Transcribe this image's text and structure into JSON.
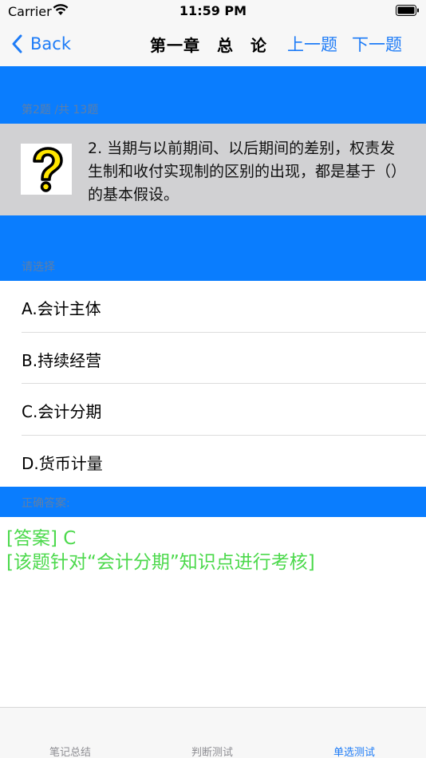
{
  "status": {
    "carrier": "Carrier",
    "time": "11:59 PM"
  },
  "nav": {
    "back_label": "Back",
    "title": "第一章　总　论",
    "prev_label": "上一题",
    "next_label": "下一题"
  },
  "question": {
    "counter": "第2题 /共 13题",
    "text": "2.  当期与以前期间、以后期间的差别，权责发生制和收付实现制的区别的出现，都是基于（）的基本假设。"
  },
  "options_section": {
    "label": "请选择",
    "items": [
      {
        "label": "A.会计主体"
      },
      {
        "label": "B.持续经营"
      },
      {
        "label": "C.会计分期"
      },
      {
        "label": "D.货币计量"
      }
    ]
  },
  "answer_section": {
    "label": "正确答案:",
    "answer_line": "[答案] C",
    "explanation_line": "[该题针对“会计分期”知识点进行考核]"
  },
  "tabs": [
    {
      "label": "笔记总结"
    },
    {
      "label": "判断测试"
    },
    {
      "label": "单选测试"
    }
  ],
  "colors": {
    "accent": "#1e7cf7",
    "band": "#0a7dfe",
    "answer": "#4cd94c",
    "question_bg": "#d1d1d3"
  }
}
